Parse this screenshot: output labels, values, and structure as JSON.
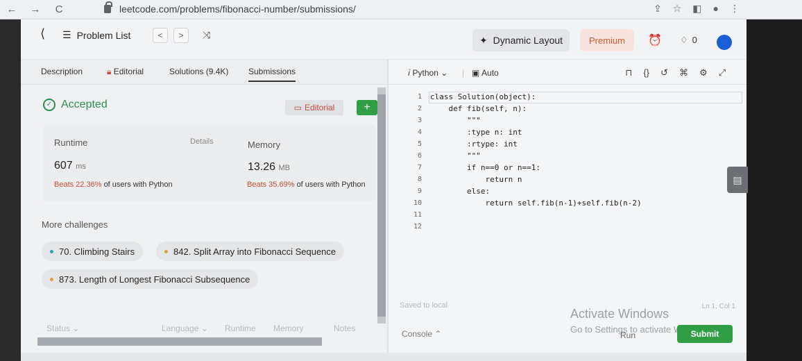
{
  "browser": {
    "url": "leetcode.com/problems/fibonacci-number/submissions/",
    "back": "←",
    "forward": "→",
    "reload": "C"
  },
  "header": {
    "problem_list": "Problem List",
    "prev": "<",
    "next": ">",
    "dynamic_layout": "Dynamic Layout",
    "premium": "Premium",
    "streak_count": "0"
  },
  "tabs": {
    "description": "Description",
    "editorial": "Editorial",
    "solutions": "Solutions (9.4K)",
    "submissions": "Submissions"
  },
  "result": {
    "status": "Accepted",
    "editorial_button": "Editorial",
    "add_button": "+"
  },
  "stats": {
    "runtime_label": "Runtime",
    "details_link": "Details",
    "runtime_value": "607",
    "runtime_unit": "ms",
    "runtime_beats_pct": "Beats 22.36%",
    "runtime_beats_text": "of users with Python",
    "memory_label": "Memory",
    "memory_value": "13.26",
    "memory_unit": "MB",
    "memory_beats_pct": "Beats 35.69%",
    "memory_beats_text": "of users with Python"
  },
  "challenges": {
    "heading": "More challenges",
    "items": [
      {
        "label": "70. Climbing Stairs",
        "color": "#2aa3b8"
      },
      {
        "label": "842. Split Array into Fibonacci Sequence",
        "color": "#e0a13a"
      },
      {
        "label": "873. Length of Longest Fibonacci Subsequence",
        "color": "#e0a13a"
      }
    ]
  },
  "table_header": {
    "status": "Status",
    "language": "Language",
    "runtime": "Runtime",
    "memory": "Memory",
    "notes": "Notes"
  },
  "editor": {
    "language": "Python",
    "mode": "Auto",
    "lines": [
      {
        "n": "1",
        "text": "class Solution(object):"
      },
      {
        "n": "2",
        "text": "    def fib(self, n):"
      },
      {
        "n": "3",
        "text": "        \"\"\""
      },
      {
        "n": "4",
        "text": "        :type n: int"
      },
      {
        "n": "5",
        "text": "        :rtype: int"
      },
      {
        "n": "6",
        "text": "        \"\"\""
      },
      {
        "n": "7",
        "text": "        if n==0 or n==1:"
      },
      {
        "n": "8",
        "text": "            return n"
      },
      {
        "n": "9",
        "text": "        else:"
      },
      {
        "n": "10",
        "text": "            return self.fib(n-1)+self.fib(n-2)"
      },
      {
        "n": "11",
        "text": ""
      },
      {
        "n": "12",
        "text": ""
      }
    ],
    "saved": "Saved to local",
    "cursor_pos": "Ln 1, Col 1",
    "console": "Console",
    "run": "Run",
    "submit": "Submit"
  },
  "watermark": {
    "line1": "Activate Windows",
    "line2": "Go to Settings to activate Windows."
  }
}
